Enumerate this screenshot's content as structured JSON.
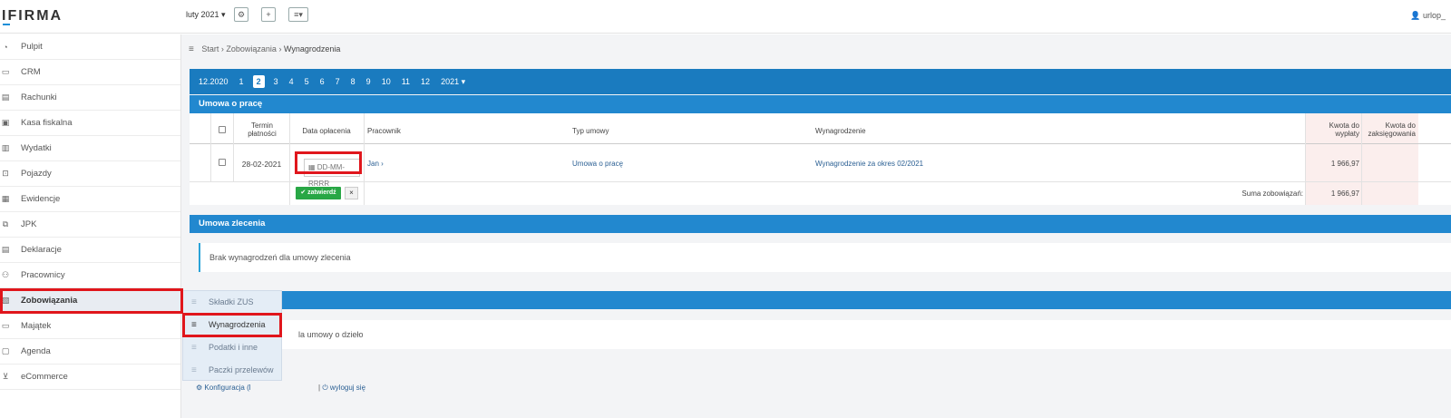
{
  "header": {
    "logo": "IFIRMA",
    "period": "luty 2021 ▾",
    "user": "urlop_"
  },
  "sidebar": {
    "items": [
      {
        "label": "Pulpit",
        "icon": "gauge-icon"
      },
      {
        "label": "CRM",
        "icon": "window-icon"
      },
      {
        "label": "Rachunki",
        "icon": "document-icon"
      },
      {
        "label": "Kasa fiskalna",
        "icon": "register-icon"
      },
      {
        "label": "Wydatki",
        "icon": "receipt-icon"
      },
      {
        "label": "Pojazdy",
        "icon": "car-icon"
      },
      {
        "label": "Ewidencje",
        "icon": "building-icon"
      },
      {
        "label": "JPK",
        "icon": "files-icon"
      },
      {
        "label": "Deklaracje",
        "icon": "form-icon"
      },
      {
        "label": "Pracownicy",
        "icon": "people-icon"
      },
      {
        "label": "Zobowiązania",
        "icon": "clipboard-icon"
      },
      {
        "label": "Majątek",
        "icon": "monitor-icon"
      },
      {
        "label": "Agenda",
        "icon": "calendar-icon"
      },
      {
        "label": "eCommerce",
        "icon": "cart-icon"
      }
    ]
  },
  "breadcrumb": {
    "start": "Start",
    "level1": "Zobowiązania",
    "level2": "Wynagrodzenia",
    "sep": "›"
  },
  "months": {
    "prev": "12.2020",
    "items": [
      "1",
      "2",
      "3",
      "4",
      "5",
      "6",
      "7",
      "8",
      "9",
      "10",
      "11",
      "12"
    ],
    "current": "2",
    "year": "2021 ▾"
  },
  "umowa_o_prace": {
    "title": "Umowa o pracę",
    "columns": {
      "termin": "Termin płatności",
      "data": "Data opłacenia",
      "pracownik": "Pracownik",
      "typ": "Typ umowy",
      "wynagrodzenie": "Wynagrodzenie",
      "kwota_wyplaty": "Kwota do wypłaty",
      "kwota_zaksiegowania": "Kwota do zaksięgowania"
    },
    "row": {
      "termin": "28-02-2021",
      "data_placeholder": "DD-MM-RRRR",
      "pracownik": "Jan ›",
      "typ": "Umowa o pracę",
      "wynagrodzenie": "Wynagrodzenie za okres 02/2021",
      "kwota": "1 966,97"
    },
    "approve_label": "zatwierdź",
    "cancel_label": "×",
    "sum_label": "Suma zobowiązań:",
    "sum_value": "1 966,97"
  },
  "umowa_zlecenia": {
    "title": "Umowa zlecenia",
    "empty": "Brak wynagrodzeń dla umowy zlecenia"
  },
  "umowa_o_dzielo": {
    "empty_partial": "la umowy o dzieło"
  },
  "submenu": {
    "items": [
      "Składki ZUS",
      "Wynagrodzenia",
      "Podatki i inne",
      "Paczki przelewów"
    ]
  },
  "footer": {
    "config": "Konfiguracja (l",
    "config_end": "| ",
    "logout": "wyloguj się"
  }
}
